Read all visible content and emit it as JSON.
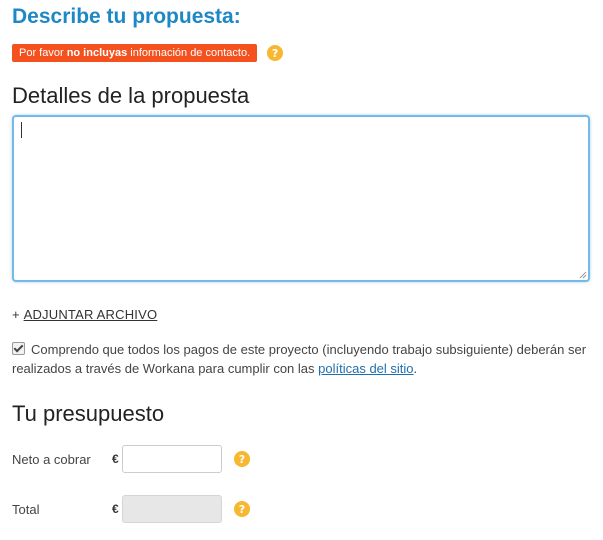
{
  "header": {
    "title": "Describe tu propuesta:"
  },
  "warning": {
    "prefix": "Por favor ",
    "emphasis": "no incluyas",
    "suffix": " información de contacto.",
    "help_icon": "question-circle-icon"
  },
  "details": {
    "title": "Detalles de la propuesta",
    "value": ""
  },
  "attach": {
    "plus": "+",
    "label": "ADJUNTAR ARCHIVO"
  },
  "terms": {
    "checked": true,
    "text": "Comprendo que todos los pagos de este proyecto (incluyendo trabajo subsiguiente) deberán ser realizados a través de Workana para cumplir con las ",
    "link": "políticas del sitio",
    "end": "."
  },
  "budget": {
    "title": "Tu presupuesto",
    "net_label": "Neto a cobrar",
    "total_label": "Total",
    "currency": "€",
    "net_value": "",
    "total_value": ""
  },
  "colors": {
    "accent": "#1e88c6",
    "warning_bg": "#f4511e",
    "help_icon": "#f7b731"
  }
}
